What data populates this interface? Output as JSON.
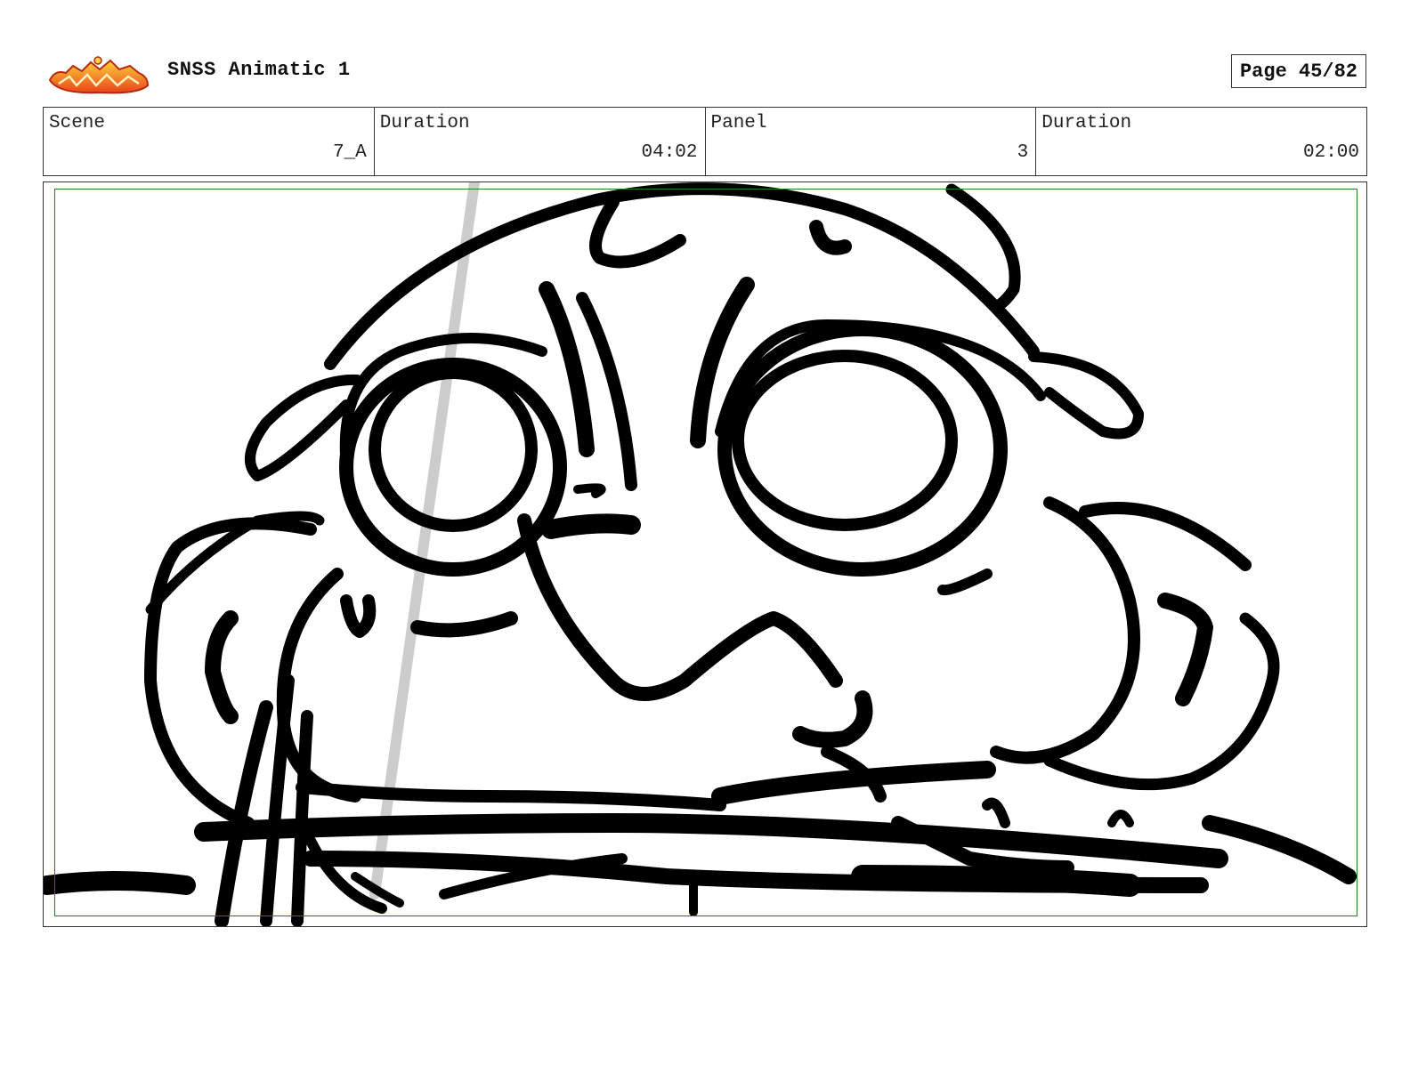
{
  "header": {
    "logo_icon": "sir-fairy-logo-icon",
    "logo_colors": [
      "#e8431a",
      "#f6a21c",
      "#ffd23c"
    ],
    "title": "SNSS Animatic 1",
    "page_label": "Page 45/82"
  },
  "info": {
    "scene_label": "Scene",
    "scene_value": "7_A",
    "duration_label": "Duration",
    "duration_value": "04:02",
    "panel_label": "Panel",
    "panel_value": "3",
    "panel_duration_label": "Duration",
    "panel_duration_value": "02:00"
  },
  "panel": {
    "safe_frame_color": "#2a7a2a",
    "sketch_icon": "character-face-sketch-icon"
  }
}
